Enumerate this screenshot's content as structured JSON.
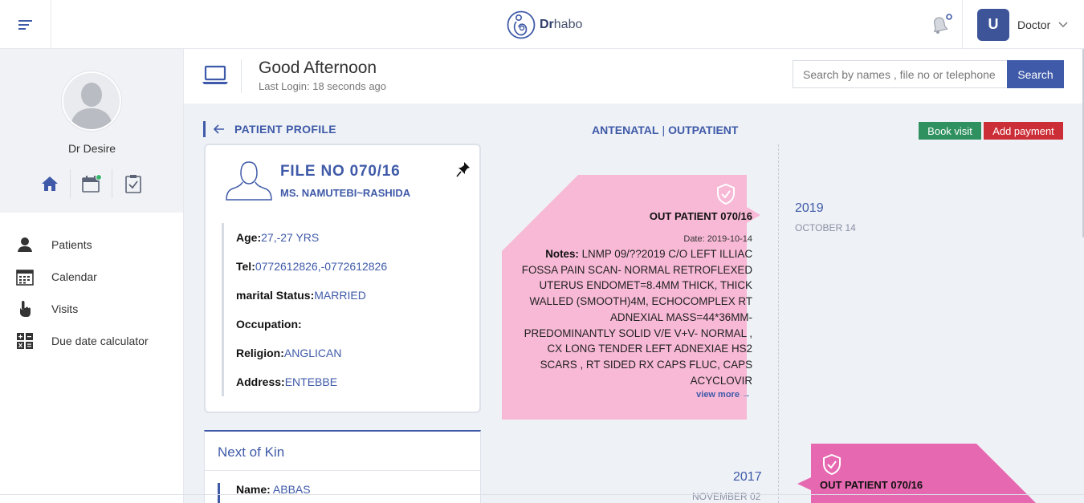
{
  "app": {
    "logo_bold": "Dr",
    "logo_rest": "habo"
  },
  "user": {
    "initial": "U",
    "name": "Doctor"
  },
  "sidebar": {
    "doctor_name": "Dr Desire",
    "items": [
      {
        "label": "Patients",
        "icon": "user-icon"
      },
      {
        "label": "Calendar",
        "icon": "calendar-grid-icon"
      },
      {
        "label": "Visits",
        "icon": "pointer-hand-icon"
      },
      {
        "label": "Due date calculator",
        "icon": "calculator-icon"
      }
    ]
  },
  "header": {
    "greeting": "Good Afternoon",
    "last_login": "Last Login: 18 seconds ago",
    "search_placeholder": "Search by names , file no or telephone",
    "search_button": "Search"
  },
  "content": {
    "breadcrumb": "PATIENT PROFILE",
    "tab_antenatal": "ANTENATAL",
    "tab_sep": "|",
    "tab_outpatient": "OUTPATIENT",
    "book_visit": "Book visit",
    "add_payment": "Add payment"
  },
  "patient": {
    "file_no": "FILE NO 070/16",
    "name": "MS. NAMUTEBI~RASHIDA",
    "details": [
      {
        "label": "Age:",
        "value": " 27,-27 YRS"
      },
      {
        "label": "Tel:",
        "value": "0772612826,-0772612826"
      },
      {
        "label": "marital Status:",
        "value": " MARRIED"
      },
      {
        "label": "Occupation:",
        "value": ""
      },
      {
        "label": "Religion:",
        "value": " ANGLICAN"
      },
      {
        "label": "Address:",
        "value": " ENTEBBE"
      }
    ]
  },
  "kin": {
    "title": "Next of Kin",
    "name_label": "Name:",
    "name_value": " ABBAS"
  },
  "timeline": {
    "entries": [
      {
        "year": "2019",
        "date": "OCTOBER 14",
        "title": "OUT PATIENT 070/16",
        "date_line": "Date: 2019-10-14",
        "notes_label": "Notes:",
        "notes": " LNMP 09/??2019 C/O LEFT ILLIAC FOSSA PAIN SCAN- NORMAL RETROFLEXED UTERUS ENDOMET=8.4MM THICK, THICK WALLED (SMOOTH)4M, ECHOCOMPLEX RT ADNEXIAL MASS=44*36MM- PREDOMINANTLY SOLID V/E V+V- NORMAL , CX LONG TENDER LEFT ADNEXIAE HS2 SCARS , RT SIDED RX CAPS FLUC, CAPS ACYCLOVIR",
        "view_more": "view more →",
        "color": "#f8b9d6"
      },
      {
        "year": "2017",
        "date": "NOVEMBER 02",
        "title": "OUT PATIENT 070/16",
        "color": "#e668b0"
      }
    ]
  },
  "colors": {
    "accent": "#3f5aa8",
    "green": "#2f9160",
    "red": "#cc2e37"
  }
}
